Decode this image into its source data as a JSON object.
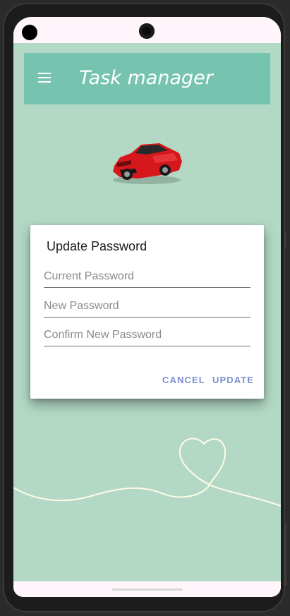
{
  "toolbar": {
    "title": "Task manager"
  },
  "profile": {
    "name": ""
  },
  "dialog": {
    "title": "Update Password",
    "fields": {
      "current_placeholder": "Current Password",
      "new_placeholder": "New Password",
      "confirm_placeholder": "Confirm New Password"
    },
    "cancel_label": "CANCEL",
    "update_label": "UPDATE"
  },
  "colors": {
    "app_background": "#b3d9c6",
    "toolbar": "#76c3b0",
    "dialog_button": "#7b8fcf",
    "car": "#d6181d"
  },
  "icons": {
    "menu": "menu-icon",
    "car": "car-image",
    "heart_wave": "heart-decoration"
  }
}
